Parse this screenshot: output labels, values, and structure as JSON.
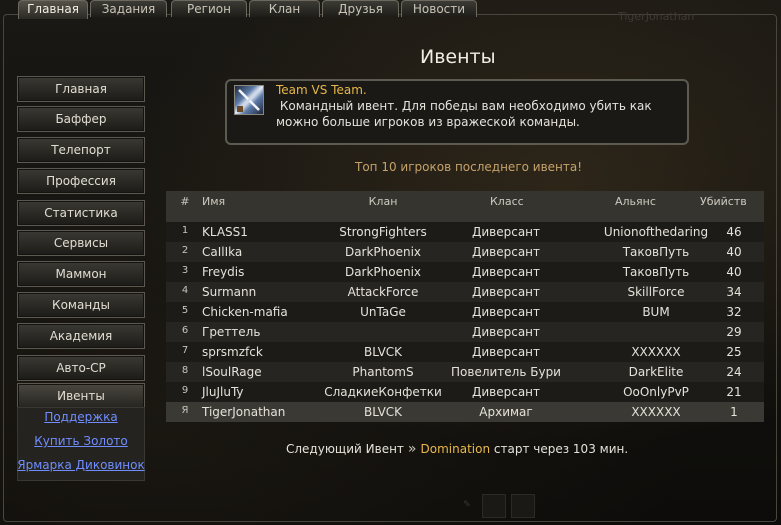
{
  "tabs": [
    {
      "label": "Главная",
      "active": true
    },
    {
      "label": "Задания",
      "active": false
    },
    {
      "label": "Регион",
      "active": false
    },
    {
      "label": "Клан",
      "active": false
    },
    {
      "label": "Друзья",
      "active": false
    },
    {
      "label": "Новости",
      "active": false
    }
  ],
  "ghost_player": "TigerJonathan",
  "sidebar": {
    "items": [
      {
        "label": "Главная"
      },
      {
        "label": "Баффер"
      },
      {
        "label": "Телепорт"
      },
      {
        "label": "Профессия"
      },
      {
        "label": "Статистика"
      },
      {
        "label": "Сервисы"
      },
      {
        "label": "Маммон"
      },
      {
        "label": "Команды"
      },
      {
        "label": "Академия"
      },
      {
        "label": "Авто-СР"
      },
      {
        "label": "Ивенты",
        "selected": true
      }
    ],
    "links": [
      {
        "label": "Поддержка"
      },
      {
        "label": "Купить Золото"
      },
      {
        "label": "Ярмарка Диковинок"
      }
    ]
  },
  "page_title": "Ивенты",
  "event": {
    "name": "Team VS Team.",
    "description": " Командный ивент. Для победы вам необходимо убить как можно больше игроков из вражеской команды.",
    "icon": "crossed-swords-icon"
  },
  "top10_caption": "Топ 10 игроков последнего ивента!",
  "table": {
    "headers": {
      "num": "#",
      "name": "Имя",
      "clan": "Клан",
      "class": "Класс",
      "ally": "Альянс",
      "kills": "Убийств"
    },
    "rows": [
      {
        "num": "1",
        "name": "KLASS1",
        "clan": "StrongFighters",
        "class": "Диверсант",
        "ally": "Unionofthedaring",
        "kills": "46"
      },
      {
        "num": "2",
        "name": "CaIlIka",
        "clan": "DarkPhoenix",
        "class": "Диверсант",
        "ally": "ТаковПуть",
        "kills": "40"
      },
      {
        "num": "3",
        "name": "Freydis",
        "clan": "DarkPhoenix",
        "class": "Диверсант",
        "ally": "ТаковПуть",
        "kills": "40"
      },
      {
        "num": "4",
        "name": "Surmann",
        "clan": "AttackForce",
        "class": "Диверсант",
        "ally": "SkillForce",
        "kills": "34"
      },
      {
        "num": "5",
        "name": "Chicken-mafia",
        "clan": "UnTaGe",
        "class": "Диверсант",
        "ally": "BUM",
        "kills": "32"
      },
      {
        "num": "6",
        "name": "Греттель",
        "clan": "",
        "class": "Диверсант",
        "ally": "",
        "kills": "29"
      },
      {
        "num": "7",
        "name": "sprsmzfck",
        "clan": "BLVCK",
        "class": "Диверсант",
        "ally": "XXXXXX",
        "kills": "25"
      },
      {
        "num": "8",
        "name": "lSoulRage",
        "clan": "PhantomS",
        "class": "Повелитель Бури",
        "ally": "DarkElite",
        "kills": "24"
      },
      {
        "num": "9",
        "name": "JluJluTy",
        "clan": "СладкиеКонфетки",
        "class": "Диверсант",
        "ally": "OoOnlyPvP",
        "kills": "21"
      }
    ],
    "self_row": {
      "num": "Я",
      "name": "TigerJonathan",
      "clan": "BLVCK",
      "class": "Архимаг",
      "ally": "XXXXXX",
      "kills": "1"
    }
  },
  "next_event": {
    "prefix": "Следующий Ивент",
    "arrow": "»",
    "name": "Domination",
    "suffix": "старт через 103 мин."
  },
  "footer_icons": [
    "pencil-icon",
    "slot-icon",
    "slot-icon"
  ]
}
